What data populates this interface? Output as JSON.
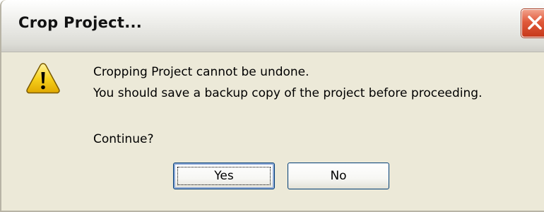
{
  "window": {
    "title": "Crop Project...",
    "close_icon": "close-icon"
  },
  "message": {
    "icon": "warning-icon",
    "line1": "Cropping Project cannot be undone.",
    "line2": "You should save a backup copy of the project before proceeding.",
    "question": "Continue?"
  },
  "buttons": {
    "yes_label": "Yes",
    "no_label": "No"
  },
  "colors": {
    "dialog_bg": "#ece9d8",
    "close_red": "#e0593a",
    "warning_yellow": "#f7d21e",
    "button_border": "#003c74"
  }
}
